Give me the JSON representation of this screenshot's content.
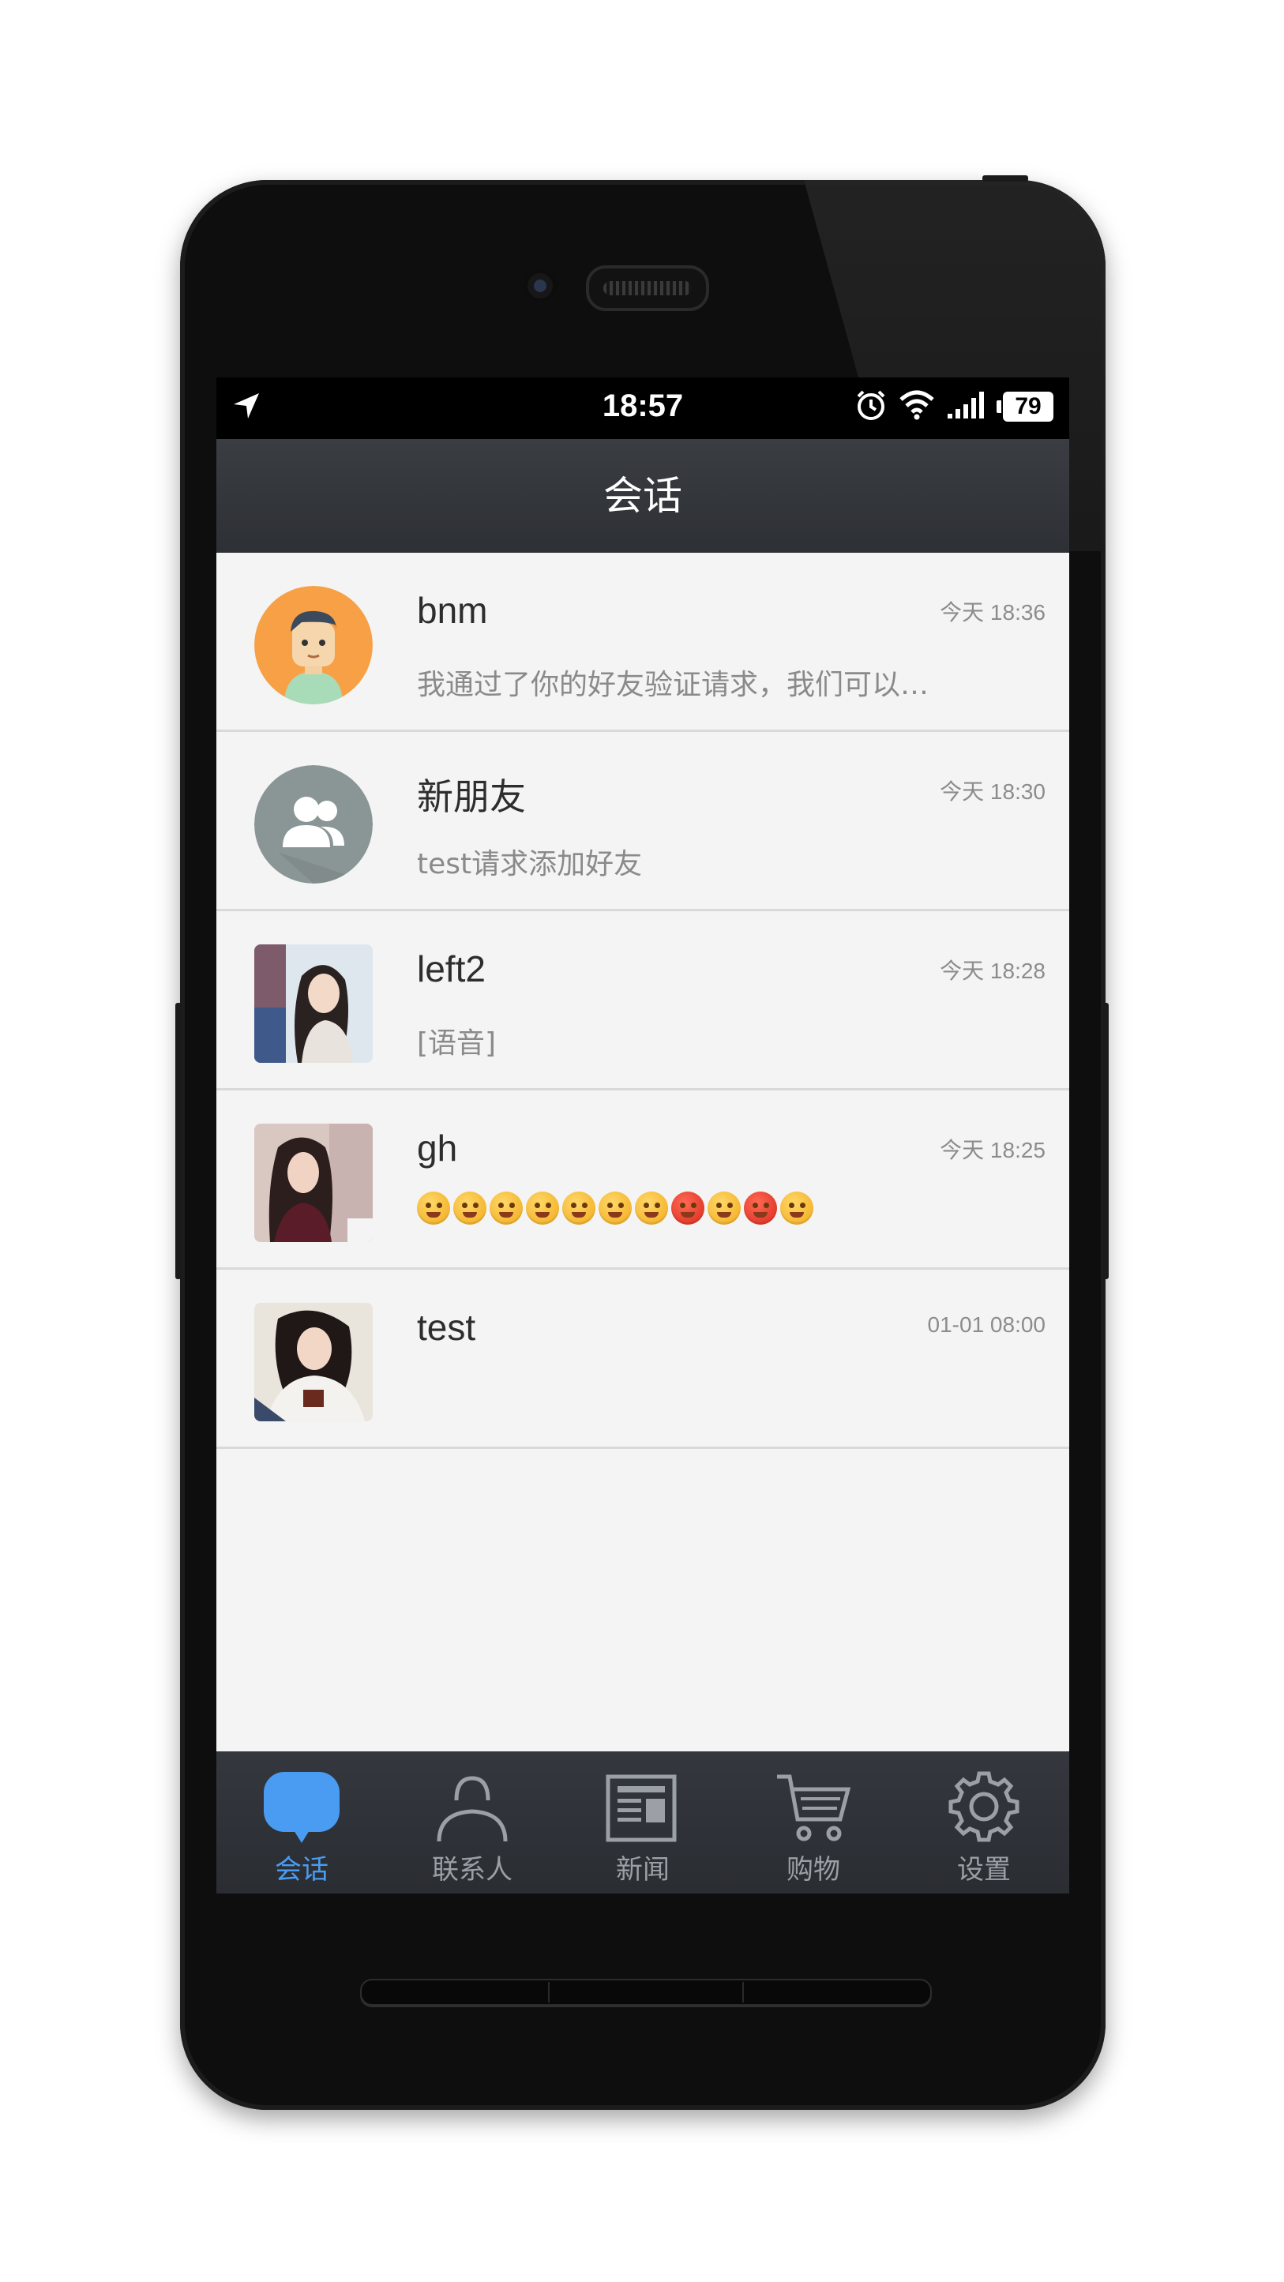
{
  "status_bar": {
    "time": "18:57",
    "battery": "79",
    "icons": [
      "location-arrow-icon",
      "alarm-icon",
      "wifi-icon",
      "signal-icon",
      "battery-icon"
    ]
  },
  "header": {
    "title": "会话"
  },
  "conversations": [
    {
      "name": "bnm",
      "time": "今天 18:36",
      "preview": "我通过了你的好友验证请求，我们可以…",
      "avatar": "cartoon-man-avatar"
    },
    {
      "name": "新朋友",
      "time": "今天 18:30",
      "preview": "test请求添加好友",
      "avatar": "group-avatar"
    },
    {
      "name": "left2",
      "time": "今天 18:28",
      "preview": "[语音]",
      "avatar": "photo-avatar"
    },
    {
      "name": "gh",
      "time": "今天 18:25",
      "preview": "",
      "avatar": "photo-avatar",
      "emoji_count": 11
    },
    {
      "name": "test",
      "time": "01-01 08:00",
      "preview": "",
      "avatar": "photo-avatar"
    }
  ],
  "tabs": [
    {
      "label": "会话",
      "icon": "chat-bubble-icon",
      "active": true
    },
    {
      "label": "联系人",
      "icon": "person-icon",
      "active": false
    },
    {
      "label": "新闻",
      "icon": "newspaper-icon",
      "active": false
    },
    {
      "label": "购物",
      "icon": "cart-icon",
      "active": false
    },
    {
      "label": "设置",
      "icon": "gear-icon",
      "active": false
    }
  ],
  "colors": {
    "accent": "#4a9cf2",
    "titlebar": "#33363b",
    "list_bg": "#f3f4f3",
    "tab_inactive": "#9aa0a6"
  }
}
